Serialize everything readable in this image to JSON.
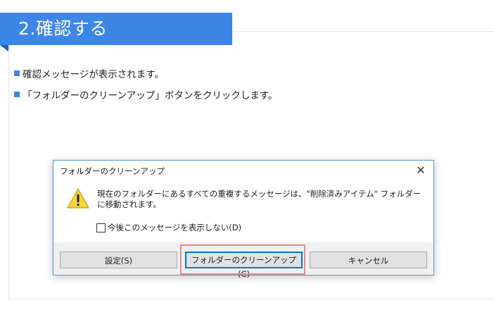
{
  "step": {
    "title": "2.確認する"
  },
  "instructions": [
    "確認メッセージが表示されます。",
    "「フォルダーのクリーンアップ」ボタンをクリックします。"
  ],
  "dialog": {
    "title": "フォルダーのクリーンアップ",
    "close_label": "✕",
    "message": "現在のフォルダーにあるすべての重複するメッセージは、\"削除済みアイテム\" フォルダーに移動されます。",
    "checkbox_label": "今後このメッセージを表示しない(D)",
    "checkbox_checked": false,
    "buttons": {
      "settings": "設定(S)",
      "cleanup": "フォルダーのクリーンアップ(C)",
      "cancel": "キャンセル"
    }
  },
  "colors": {
    "accent": "#3e86e5",
    "highlight": "#ea8a85",
    "focus": "#0078d7"
  }
}
